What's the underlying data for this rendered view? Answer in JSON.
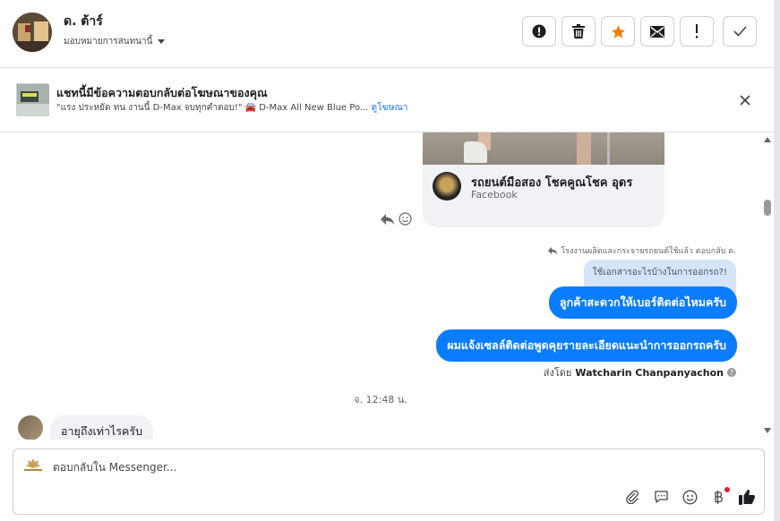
{
  "header": {
    "contact_name": "ด. ต้าร์",
    "assign_label": "มอบหมายการสนทนานี้",
    "actions": [
      {
        "name": "spam-button",
        "icon": "alert-circle-icon"
      },
      {
        "name": "delete-button",
        "icon": "trash-icon"
      },
      {
        "name": "star-button",
        "icon": "star-icon"
      },
      {
        "name": "mark-unread-button",
        "icon": "envelope-icon"
      },
      {
        "name": "follow-up-button",
        "icon": "exclamation-icon"
      },
      {
        "name": "mark-done-button",
        "icon": "check-icon"
      }
    ],
    "accent": "#f57c00"
  },
  "ad_banner": {
    "title": "แชทนี้มีข้อความตอบกลับต่อโฆษณาของคุณ",
    "subtitle": "\"แรง ประหยัด ทน งานนี้ D-Max จบทุกคำตอบ!\" 🚘 D-Max All New Blue Po...",
    "link_label": "ดูโฆษณา"
  },
  "conversation": {
    "shared_card": {
      "page_name": "รถยนต์มือสอง โชคคูณโชค อุดร",
      "source": "Facebook"
    },
    "reply_context": "โรงงานผลิตและกระจายรถยนต์ใช้แล้ว ตอบกลับ ต.",
    "quoted_message": "ใช้เอกสารอะไรบ้างในการออกรถ?!",
    "outgoing": [
      "ลูกค้าสะดวกให้เบอร์ติดต่อไหมครับ",
      "ผมแจ้งเซลล์ติดต่อพูดคุยรายละเอียดแนะนำการออกรถครับ"
    ],
    "sent_by_prefix": "ส่งโดย",
    "sent_by_name": "Watcharin Chanpanyachon",
    "timestamp": "จ. 12:48 น.",
    "incoming": "อายุถึงเท่าไรครับ",
    "outgoing_bubble_color": "#0a7cff"
  },
  "composer": {
    "placeholder": "ตอบกลับใน Messenger...",
    "tools": [
      "attachment-icon",
      "saved-reply-icon",
      "emoji-icon",
      "baht-icon",
      "thumbs-up-icon"
    ],
    "brand_color": "#1877f2"
  }
}
